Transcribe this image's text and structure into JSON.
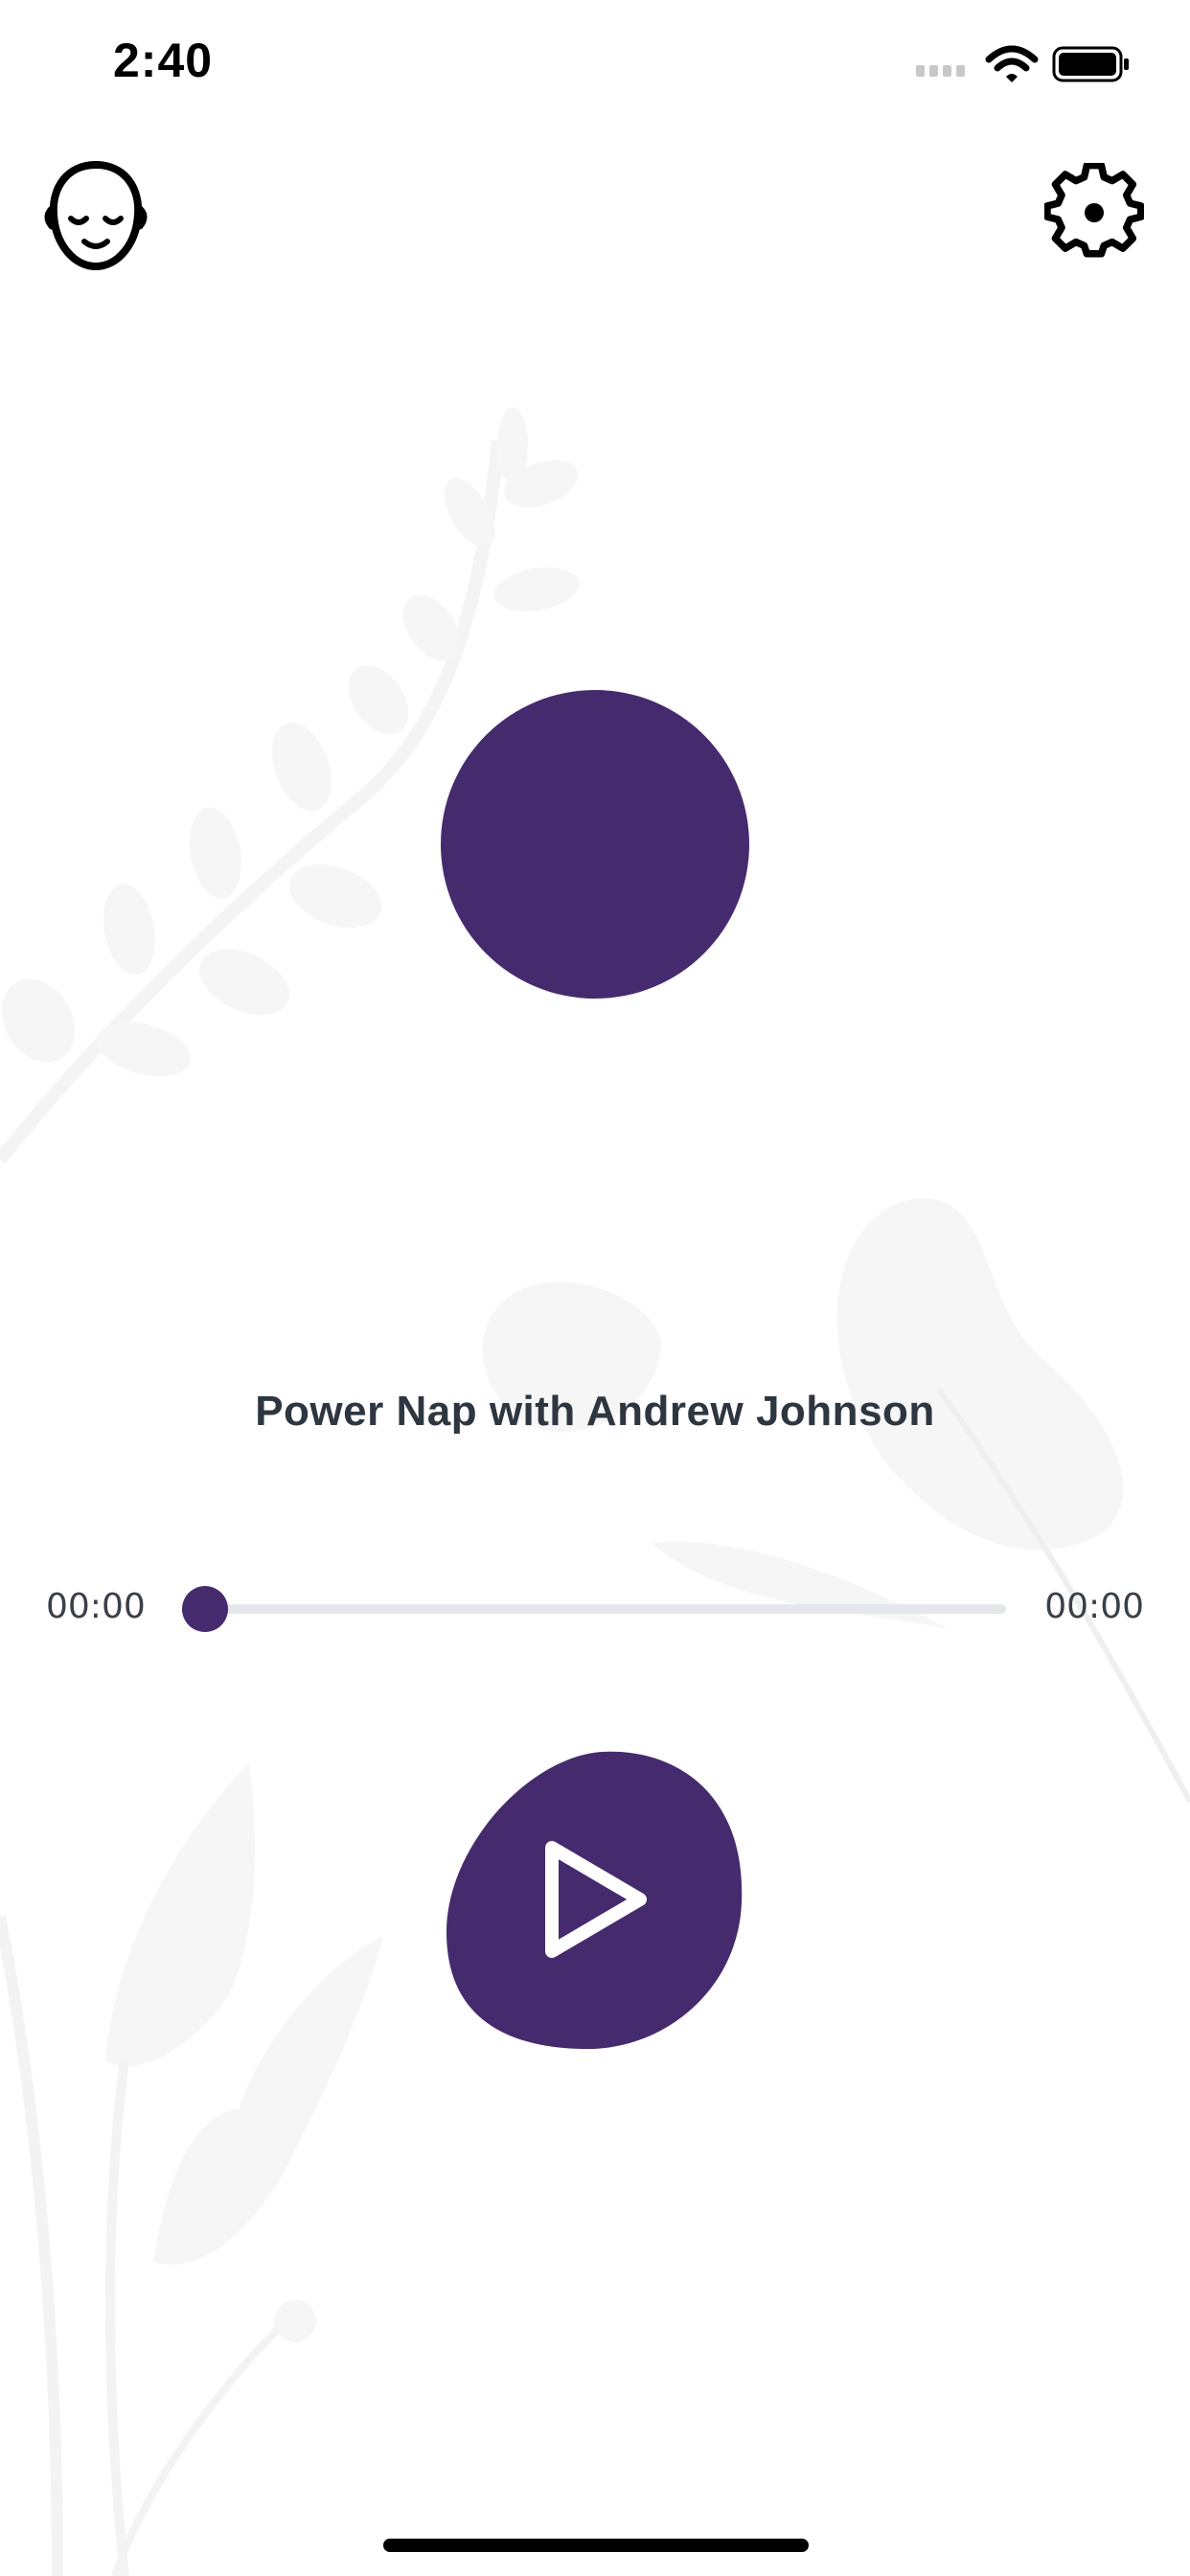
{
  "status_bar": {
    "time": "2:40",
    "icons": [
      "cellular-signal-icon",
      "wifi-icon",
      "battery-icon"
    ]
  },
  "header": {
    "left_icon": "meditating-face-icon",
    "right_icon": "gear-icon"
  },
  "player": {
    "title": "Power Nap with Andrew Johnson",
    "elapsed": "00:00",
    "duration": "00:00",
    "progress": 0,
    "play_icon": "play-icon"
  },
  "colors": {
    "accent": "#452b6e",
    "text": "#2e3640",
    "track": "#e6e7ea",
    "background_art": "#f7f7f7"
  }
}
